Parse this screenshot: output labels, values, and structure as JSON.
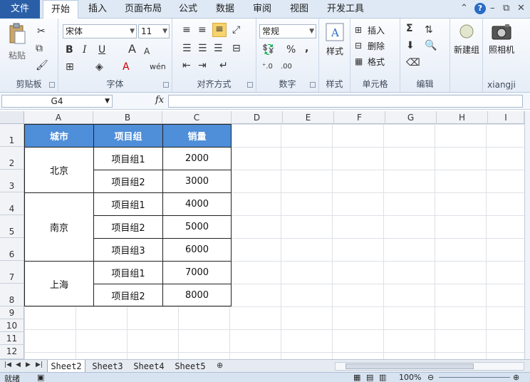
{
  "ribbon_tabs": [
    "文件",
    "开始",
    "插入",
    "页面布局",
    "公式",
    "数据",
    "审阅",
    "视图",
    "开发工具"
  ],
  "clipboard": {
    "paste": "粘贴",
    "label": "剪贴板"
  },
  "font": {
    "name": "宋体",
    "size": "11",
    "label": "字体",
    "bold": "B",
    "italic": "I",
    "underline": "U",
    "grow": "A",
    "shrink": "A",
    "phonetic": "wén"
  },
  "alignment": {
    "label": "对齐方式"
  },
  "number": {
    "format": "常规",
    "label": "数字",
    "percent": "%",
    "comma": ","
  },
  "styles": {
    "label": "样式",
    "btn": "样式"
  },
  "cells": {
    "label": "单元格",
    "insert": "插入",
    "delete": "删除",
    "format": "格式"
  },
  "editing": {
    "label": "编辑",
    "sum": "Σ"
  },
  "newgroup": {
    "btn": "新建组"
  },
  "camera": {
    "btn": "照相机",
    "label": "xiangji"
  },
  "formula_bar": {
    "name_box": "G4",
    "fx": "fx",
    "value": ""
  },
  "columns": [
    "A",
    "B",
    "C",
    "D",
    "E",
    "F",
    "G",
    "H",
    "I"
  ],
  "rows": [
    "1",
    "2",
    "3",
    "4",
    "5",
    "6",
    "7",
    "8",
    "9",
    "10",
    "11",
    "12"
  ],
  "table": {
    "headers": [
      "城市",
      "项目组",
      "销量"
    ],
    "cities": [
      "北京",
      "南京",
      "上海"
    ],
    "groups": [
      "项目组1",
      "项目组2",
      "项目组1",
      "项目组2",
      "项目组3",
      "项目组1",
      "项目组2"
    ],
    "sales": [
      "2000",
      "3000",
      "4000",
      "5000",
      "6000",
      "7000",
      "8000"
    ]
  },
  "sheets": [
    "Sheet2",
    "Sheet3",
    "Sheet4",
    "Sheet5"
  ],
  "status": {
    "ready": "就绪",
    "zoom": "100%"
  }
}
